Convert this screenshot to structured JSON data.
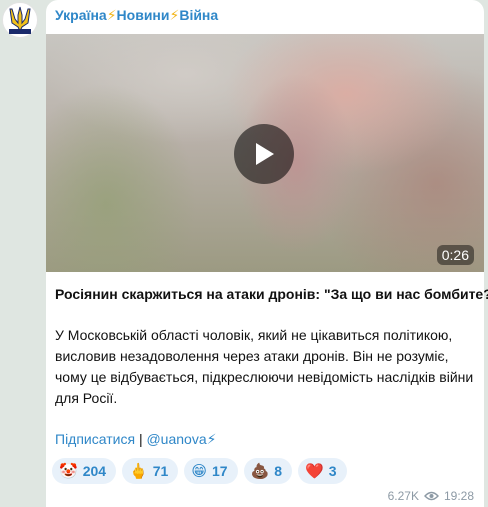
{
  "channel": {
    "part1": "Україна",
    "part2": "Новини",
    "part3": "Війна",
    "separator": "⚡"
  },
  "video": {
    "duration": "0:26"
  },
  "post": {
    "title": "Росіянин скаржиться на атаки дронів: \"За що ви нас бомбите?\"",
    "body": "У Московській області чоловік, який не цікавиться політикою, висловив незадоволення через атаки дронів. Він не розуміє, чому це відбувається, підкреслюючи невідомість наслідків війни для Росії.",
    "subscribe_link": "Підписатися",
    "divider": "|",
    "handle_link": "@uanova⚡"
  },
  "reactions": [
    {
      "emoji": "🤡",
      "count": "204"
    },
    {
      "emoji": "🖕",
      "count": "71"
    },
    {
      "emoji": "😁",
      "count": "17"
    },
    {
      "emoji": "💩",
      "count": "8"
    },
    {
      "emoji": "❤️",
      "count": "3"
    }
  ],
  "meta": {
    "views": "6.27K",
    "time": "19:28"
  },
  "colors": {
    "link": "#2f87c8",
    "bolt": "#f3b71c",
    "reaction_bg": "#e8f1fa"
  }
}
